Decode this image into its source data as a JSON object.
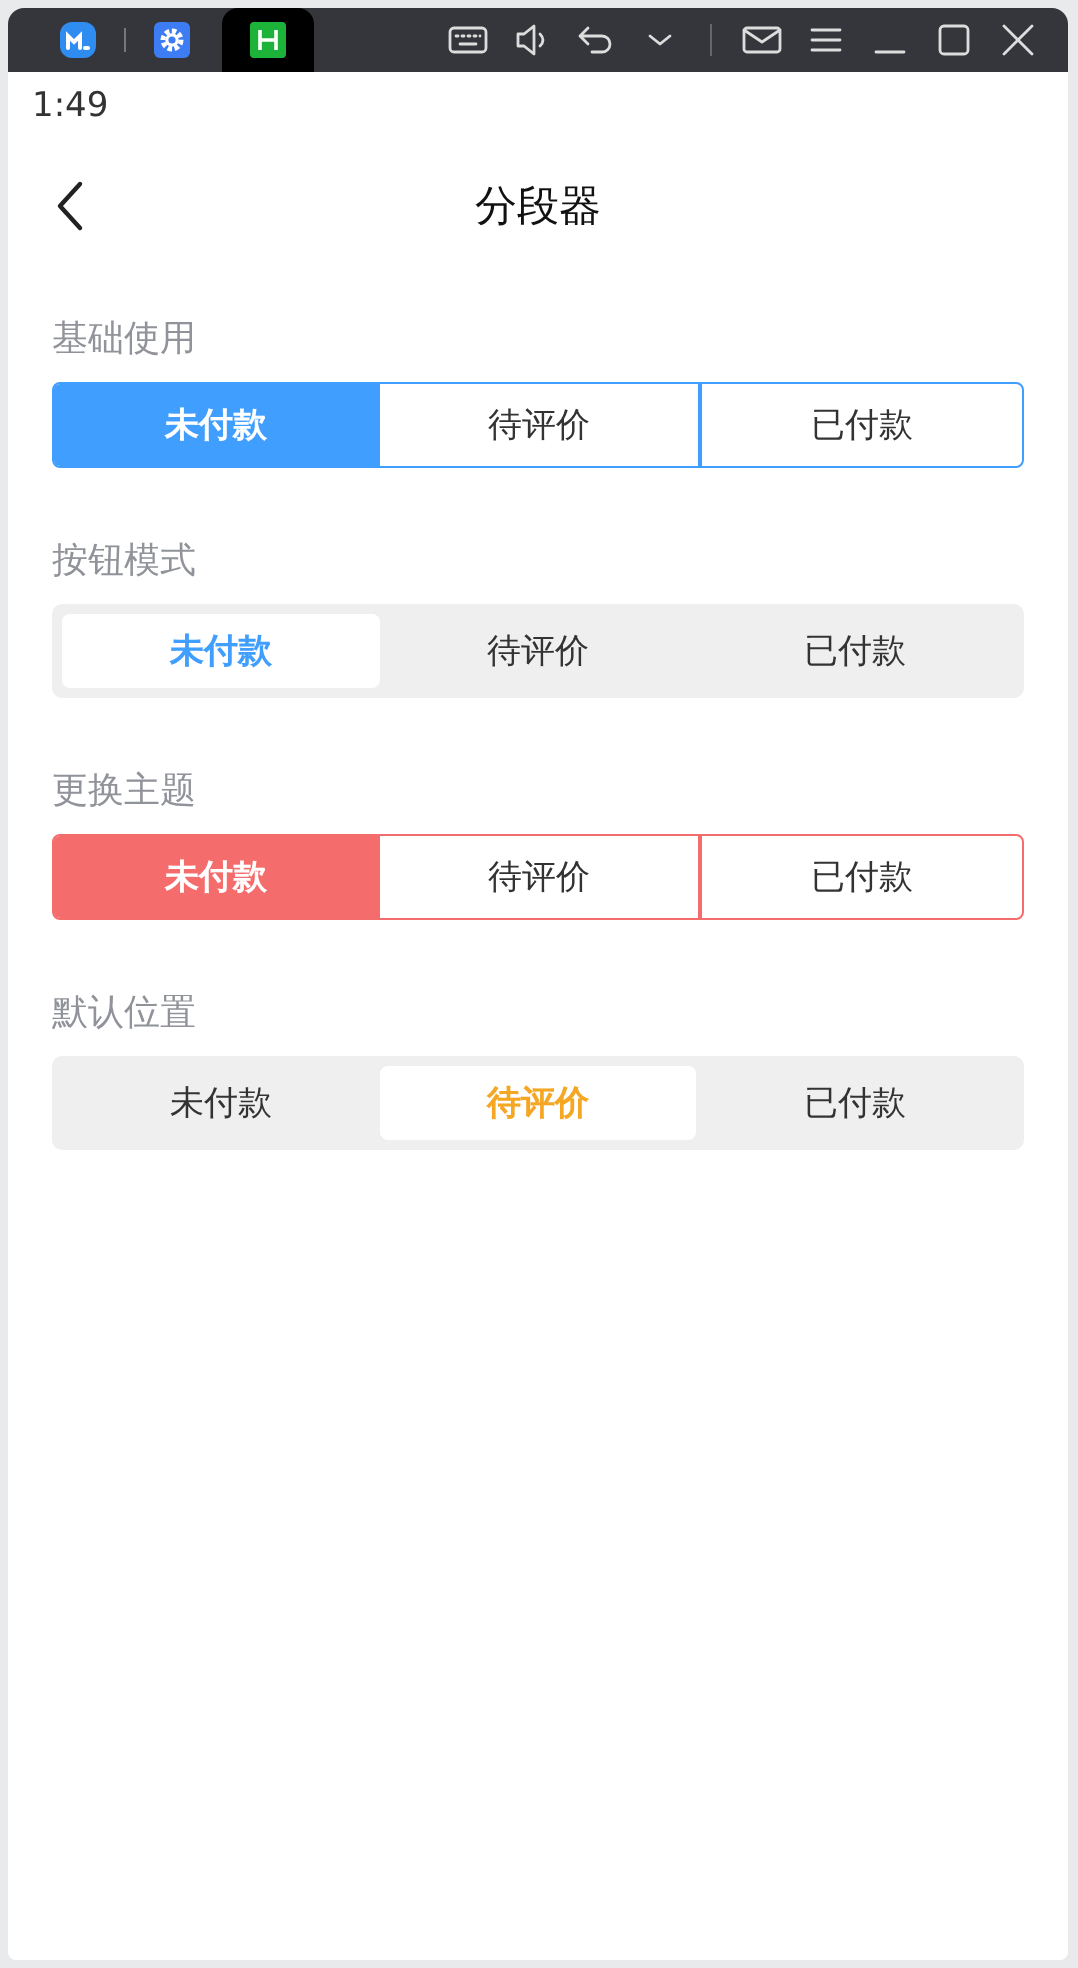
{
  "title_bar": {
    "tabs": [
      {
        "kind": "app",
        "selected": false
      },
      {
        "kind": "settings",
        "selected": false
      },
      {
        "kind": "h",
        "selected": true
      }
    ],
    "tools": [
      {
        "kind": "keyboard"
      },
      {
        "kind": "speaker"
      },
      {
        "kind": "undo"
      },
      {
        "kind": "chevron"
      },
      {
        "kind": "mail"
      },
      {
        "kind": "menu"
      },
      {
        "kind": "minimize"
      },
      {
        "kind": "maximize"
      },
      {
        "kind": "close"
      }
    ]
  },
  "status_bar": {
    "time": "1:49"
  },
  "nav": {
    "title": "分段器"
  },
  "sections": [
    {
      "label": "基础使用",
      "kind": "outline",
      "color": "#409eff",
      "segments": [
        {
          "label": "未付款",
          "selected": true
        },
        {
          "label": "待评价",
          "selected": false
        },
        {
          "label": "已付款",
          "selected": false
        }
      ]
    },
    {
      "label": "按钮模式",
      "kind": "button",
      "color": "#409eff",
      "segments": [
        {
          "label": "未付款",
          "selected": true
        },
        {
          "label": "待评价",
          "selected": false
        },
        {
          "label": "已付款",
          "selected": false
        }
      ]
    },
    {
      "label": "更换主题",
      "kind": "outline",
      "color": "#f56c6c",
      "segments": [
        {
          "label": "未付款",
          "selected": true
        },
        {
          "label": "待评价",
          "selected": false
        },
        {
          "label": "已付款",
          "selected": false
        }
      ]
    },
    {
      "label": "默认位置",
      "kind": "button",
      "color": "#f5a623",
      "segments": [
        {
          "label": "未付款",
          "selected": false
        },
        {
          "label": "待评价",
          "selected": true
        },
        {
          "label": "已付款",
          "selected": false
        }
      ]
    }
  ]
}
